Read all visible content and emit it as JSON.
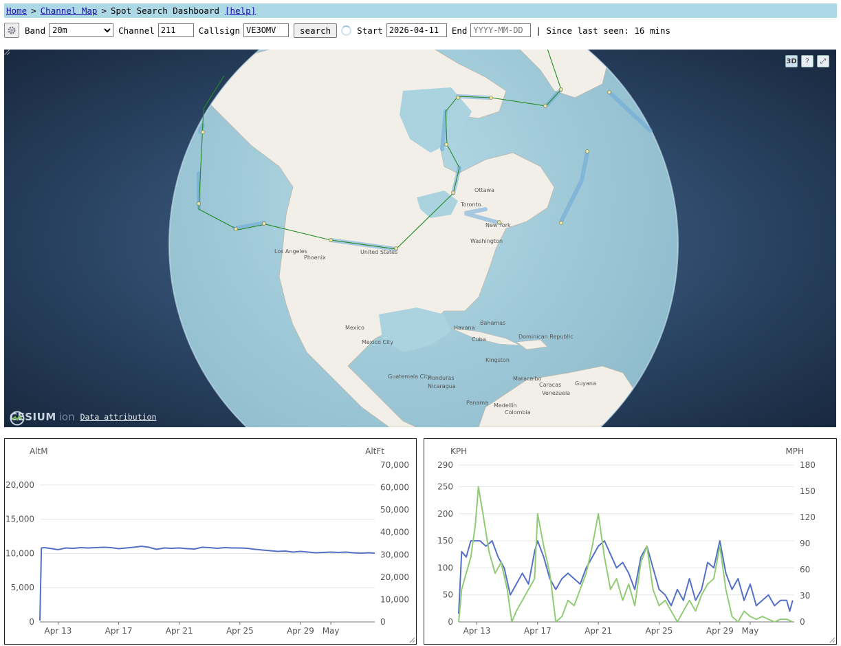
{
  "breadcrumb": {
    "home": "Home",
    "sep1": ">",
    "channel_map": "Channel Map",
    "sep2": ">",
    "current": "Spot Search Dashboard",
    "help": "[help]"
  },
  "toolbar": {
    "band_label": "Band",
    "band_value": "20m",
    "channel_label": "Channel",
    "channel_value": "211",
    "callsign_label": "Callsign",
    "callsign_value": "VE3OMV",
    "search_label": "search",
    "start_label": "Start",
    "start_value": "2026-04-11",
    "end_label": "End",
    "end_placeholder": "YYYY-MM-DD",
    "since_text": "| Since last seen: 16 mins"
  },
  "map": {
    "buttons": {
      "mode": "3D",
      "help": "?",
      "fullscreen": "⤢"
    },
    "logo_text": "CESIUM",
    "logo_ion": "ion",
    "attribution": "Data attribution",
    "labels": [
      "Ottawa",
      "Toronto",
      "New York",
      "Washington",
      "Los Angeles",
      "Phoenix",
      "United States",
      "Mexico",
      "Mexico City",
      "Havana",
      "Bahamas",
      "Cuba",
      "Dominican Republic",
      "Kingston",
      "Guatemala City",
      "Honduras",
      "Nicaragua",
      "Panama",
      "Medellín",
      "Colombia",
      "Caracas",
      "Venezuela",
      "Maracaibo",
      "Guyana"
    ],
    "colors": {
      "globe_water": "#aad3df",
      "land": "#f2efe9",
      "track": "#228b22",
      "track_halo": "#6aa8d8"
    }
  },
  "chart_data": [
    {
      "type": "line",
      "title": "",
      "ylabel_left": "AltM",
      "ylabel_right": "AltFt",
      "y_left_ticks": [
        "0",
        "5,000",
        "10,000",
        "15,000",
        "20,000"
      ],
      "y_right_ticks": [
        "0",
        "10,000",
        "20,000",
        "30,000",
        "40,000",
        "50,000",
        "60,000",
        "70,000"
      ],
      "x_ticks": [
        "Apr 13",
        "Apr 17",
        "Apr 21",
        "Apr 25",
        "Apr 29",
        "May"
      ],
      "x_days": [
        13,
        17,
        21,
        25,
        29,
        31
      ],
      "ylim": [
        0,
        21500
      ],
      "xlim": [
        11.8,
        33.9
      ],
      "series": [
        {
          "color": "#5470c6",
          "x": [
            11.8,
            11.9,
            12.1,
            12.6,
            13.0,
            13.5,
            14.0,
            14.5,
            15.0,
            15.5,
            16.0,
            16.5,
            17.0,
            17.5,
            18.0,
            18.5,
            19.0,
            19.5,
            20.0,
            20.5,
            21.0,
            21.5,
            22.0,
            22.5,
            23.0,
            23.5,
            24.0,
            24.5,
            25.0,
            25.5,
            26.0,
            26.5,
            27.0,
            27.5,
            28.0,
            28.5,
            29.0,
            29.5,
            30.0,
            30.5,
            31.0,
            31.5,
            32.0,
            32.5,
            33.0,
            33.5,
            33.9
          ],
          "y": [
            200,
            10800,
            10850,
            10700,
            10550,
            10800,
            10750,
            10850,
            10800,
            10850,
            10900,
            10850,
            10700,
            10800,
            10900,
            11050,
            10900,
            10600,
            10800,
            10750,
            10800,
            10700,
            10650,
            10900,
            10850,
            10750,
            10850,
            10800,
            10800,
            10750,
            10600,
            10500,
            10400,
            10300,
            10350,
            10200,
            10300,
            10200,
            10100,
            10150,
            10200,
            10150,
            10200,
            10100,
            10050,
            10100,
            10050
          ]
        }
      ]
    },
    {
      "type": "line",
      "title": "",
      "ylabel_left": "KPH",
      "ylabel_right": "MPH",
      "y_left_ticks": [
        "0",
        "50",
        "100",
        "150",
        "200",
        "250",
        "290"
      ],
      "y_left_values": [
        0,
        50,
        100,
        150,
        200,
        250,
        290
      ],
      "y_right_ticks": [
        "0",
        "30",
        "60",
        "90",
        "120",
        "150",
        "180"
      ],
      "x_ticks": [
        "Apr 13",
        "Apr 17",
        "Apr 21",
        "Apr 25",
        "Apr 29",
        "May"
      ],
      "x_days": [
        13,
        17,
        21,
        25,
        29,
        31
      ],
      "ylim": [
        0,
        290
      ],
      "xlim": [
        11.8,
        33.9
      ],
      "series": [
        {
          "color": "#5470c6",
          "x": [
            11.8,
            12.0,
            12.3,
            12.6,
            12.9,
            13.2,
            13.6,
            14.0,
            14.4,
            14.8,
            15.2,
            15.6,
            16.0,
            16.4,
            16.8,
            17.0,
            17.4,
            17.8,
            18.2,
            18.6,
            19.0,
            19.4,
            19.8,
            20.2,
            20.6,
            21.0,
            21.4,
            21.8,
            22.2,
            22.6,
            23.0,
            23.4,
            23.8,
            24.2,
            24.6,
            25.0,
            25.4,
            25.8,
            26.2,
            26.6,
            27.0,
            27.4,
            27.8,
            28.2,
            28.6,
            29.0,
            29.4,
            29.8,
            30.2,
            30.6,
            31.0,
            31.4,
            31.8,
            32.2,
            32.6,
            33.0,
            33.4,
            33.6,
            33.8
          ],
          "y": [
            15,
            130,
            120,
            150,
            150,
            150,
            140,
            150,
            120,
            100,
            50,
            70,
            90,
            70,
            130,
            150,
            120,
            80,
            60,
            80,
            90,
            80,
            70,
            100,
            120,
            140,
            150,
            125,
            100,
            110,
            90,
            60,
            120,
            140,
            100,
            60,
            50,
            30,
            60,
            40,
            80,
            40,
            60,
            110,
            100,
            150,
            90,
            60,
            80,
            40,
            70,
            30,
            40,
            50,
            30,
            40,
            40,
            20,
            40
          ]
        },
        {
          "color": "#91cc75",
          "x": [
            11.8,
            12.0,
            12.3,
            12.6,
            12.9,
            13.1,
            13.4,
            13.8,
            14.2,
            14.6,
            15.0,
            15.3,
            15.6,
            16.0,
            16.4,
            16.8,
            17.0,
            17.4,
            17.8,
            18.2,
            18.6,
            19.0,
            19.4,
            19.8,
            20.2,
            20.6,
            21.0,
            21.4,
            21.8,
            22.2,
            22.6,
            23.0,
            23.4,
            23.8,
            24.2,
            24.6,
            25.0,
            25.4,
            25.8,
            26.2,
            26.6,
            27.0,
            27.4,
            27.8,
            28.2,
            28.6,
            29.0,
            29.4,
            29.8,
            30.2,
            30.6,
            31.0,
            31.4,
            31.8,
            32.2,
            32.6,
            33.0,
            33.4,
            33.8
          ],
          "y": [
            0,
            60,
            90,
            120,
            180,
            250,
            200,
            130,
            90,
            110,
            60,
            0,
            20,
            40,
            60,
            80,
            200,
            140,
            90,
            0,
            10,
            40,
            30,
            60,
            90,
            140,
            200,
            120,
            60,
            80,
            40,
            70,
            30,
            110,
            140,
            60,
            30,
            40,
            20,
            0,
            20,
            40,
            20,
            50,
            70,
            80,
            140,
            60,
            10,
            0,
            20,
            10,
            5,
            10,
            5,
            0,
            5,
            5,
            0
          ]
        }
      ]
    }
  ]
}
